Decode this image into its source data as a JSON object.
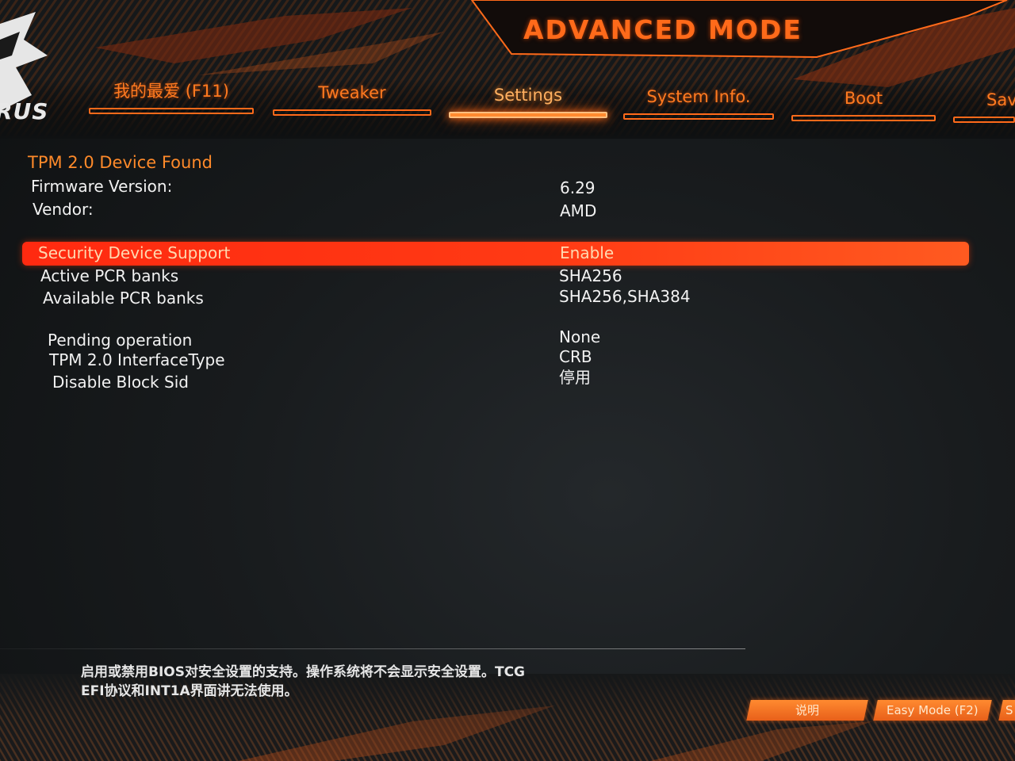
{
  "header": {
    "mode_title": "ADVANCED MODE",
    "logo_text": "RUS"
  },
  "tabs": [
    {
      "label": "我的最爱 (F11)",
      "active": false
    },
    {
      "label": "Tweaker",
      "active": false
    },
    {
      "label": "Settings",
      "active": true
    },
    {
      "label": "System Info.",
      "active": false
    },
    {
      "label": "Boot",
      "active": false
    },
    {
      "label": "Save",
      "active": false
    }
  ],
  "tpm": {
    "found_title": "TPM 2.0 Device Found",
    "firmware_label": "Firmware Version:",
    "firmware_value": "6.29",
    "vendor_label": "Vendor:",
    "vendor_value": "AMD"
  },
  "settings": {
    "security_device_support": {
      "label": "Security Device Support",
      "value": "Enable"
    },
    "active_pcr_banks": {
      "label": "Active PCR banks",
      "value": "SHA256"
    },
    "available_pcr_banks": {
      "label": "Available PCR banks",
      "value": "SHA256,SHA384"
    },
    "pending_operation": {
      "label": "Pending operation",
      "value": "None"
    },
    "tpm_interface_type": {
      "label": "TPM 2.0 InterfaceType",
      "value": "CRB"
    },
    "disable_block_sid": {
      "label": "Disable Block Sid",
      "value": "停用"
    }
  },
  "help": {
    "line1": "启用或禁用BIOS对安全设置的支持。操作系统将不会显示安全设置。TCG",
    "line2": "EFI协议和INT1A界面讲无法使用。"
  },
  "footer": {
    "help_button": "说明",
    "easy_mode_button": "Easy Mode (F2)",
    "cut_button": "S"
  },
  "colors": {
    "accent": "#ff6a1a",
    "highlight": "#ff2a10",
    "text": "#f2f2f2"
  }
}
